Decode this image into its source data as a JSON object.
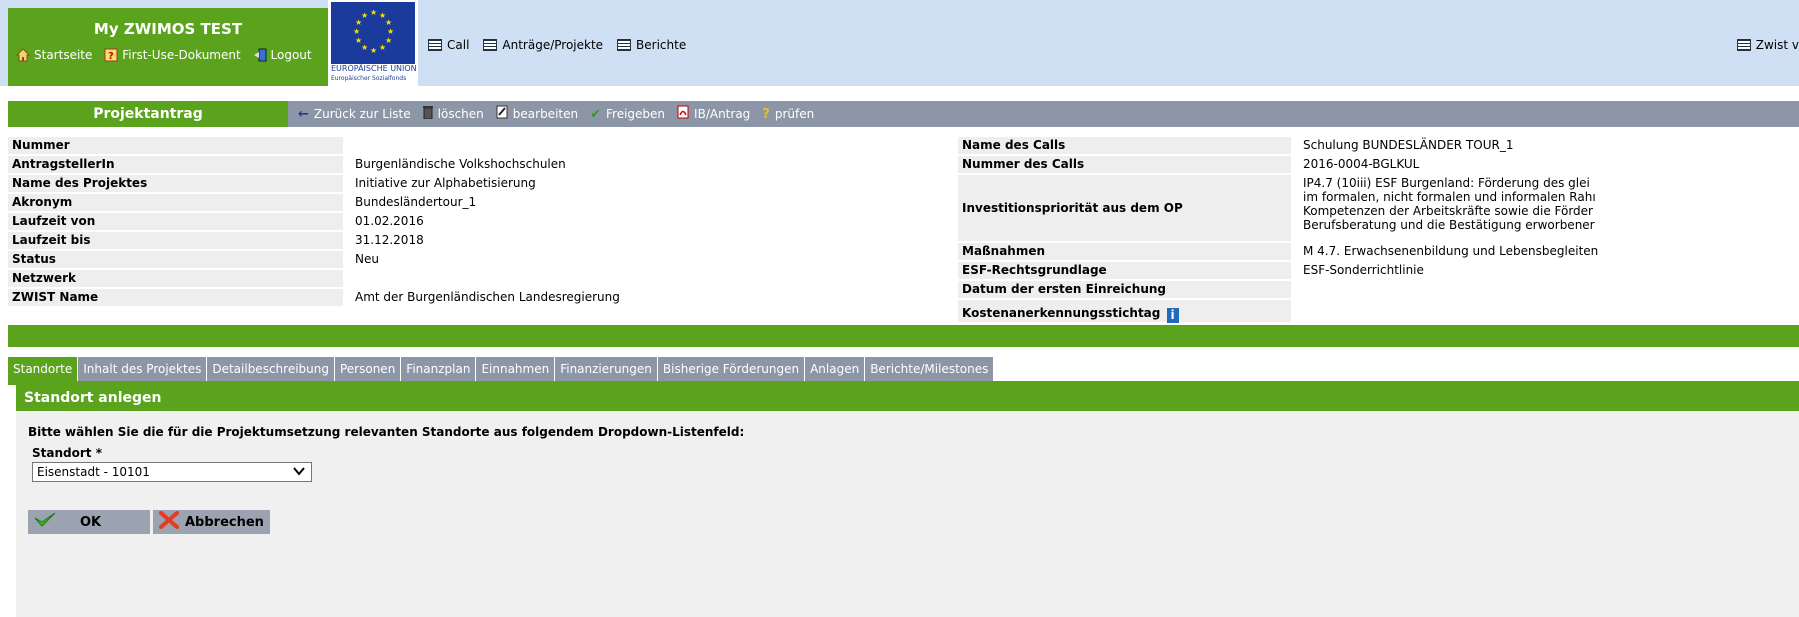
{
  "header": {
    "app_title": "My ZWIMOS TEST",
    "links": [
      {
        "label": "Startseite",
        "icon": "home-icon"
      },
      {
        "label": "First-Use-Dokument",
        "icon": "help-icon"
      },
      {
        "label": "Logout",
        "icon": "logout-icon"
      }
    ],
    "eu_line1": "EUROPÄISCHE UNION",
    "eu_line2": "Europäischer Sozialfonds",
    "nav": [
      {
        "label": "Call",
        "icon": "list-icon"
      },
      {
        "label": "Anträge/Projekte",
        "icon": "list-icon"
      },
      {
        "label": "Berichte",
        "icon": "list-icon"
      }
    ],
    "nav_right": "Zwist v"
  },
  "actionbar": {
    "title": "Projektantrag",
    "actions": [
      {
        "label": "Zurück zur Liste",
        "icon": "arrow-left-icon",
        "glyph": "←"
      },
      {
        "label": "löschen",
        "icon": "trash-icon",
        "glyph": "🗑"
      },
      {
        "label": "bearbeiten",
        "icon": "edit-icon",
        "glyph": "✎"
      },
      {
        "label": "Freigeben",
        "icon": "check-icon",
        "glyph": "✔"
      },
      {
        "label": "IB/Antrag",
        "icon": "pdf-icon",
        "glyph": "▣"
      },
      {
        "label": "prüfen",
        "icon": "question-icon",
        "glyph": "?"
      }
    ]
  },
  "project_info": [
    {
      "label": "Nummer",
      "value": ""
    },
    {
      "label": "AntragstellerIn",
      "value": "Burgenländische Volkshochschulen"
    },
    {
      "label": "Name des Projektes",
      "value": "Initiative zur Alphabetisierung"
    },
    {
      "label": "Akronym",
      "value": "Bundesländertour_1"
    },
    {
      "label": "Laufzeit von",
      "value": "01.02.2016"
    },
    {
      "label": "Laufzeit bis",
      "value": "31.12.2018"
    },
    {
      "label": "Status",
      "value": "Neu"
    },
    {
      "label": "Netzwerk",
      "value": ""
    },
    {
      "label": "ZWIST Name",
      "value": "Amt der Burgenländischen Landesregierung"
    }
  ],
  "call_info": {
    "name_label": "Name des Calls",
    "name_value": "Schulung BUNDESLÄNDER TOUR_1",
    "number_label": "Nummer des Calls",
    "number_value": "2016-0004-BGLKUL",
    "invest_label": "Investitionspriorität aus dem OP",
    "invest_lines": [
      "IP4.7 (10iii) ESF Burgenland: Förderung des glei",
      "im formalen, nicht formalen und informalen Rahı",
      "Kompetenzen der Arbeitskräfte sowie die Förder",
      "Berufsberatung und die Bestätigung erworbener"
    ],
    "massnahmen_label": "Maßnahmen",
    "massnahmen_value": "M 4.7. Erwachsenenbildung und Lebensbegleiten",
    "esf_label": "ESF-Rechtsgrundlage",
    "esf_value": "ESF-Sonderrichtlinie",
    "datum_label": "Datum der ersten Einreichung",
    "datum_value": "",
    "kosten_label": "Kostenanerkennungsstichtag"
  },
  "tabs": [
    {
      "label": "Standorte",
      "active": true
    },
    {
      "label": "Inhalt des Projektes",
      "active": false
    },
    {
      "label": "Detailbeschreibung",
      "active": false
    },
    {
      "label": "Personen",
      "active": false
    },
    {
      "label": "Finanzplan",
      "active": false
    },
    {
      "label": "Einnahmen",
      "active": false
    },
    {
      "label": "Finanzierungen",
      "active": false
    },
    {
      "label": "Bisherige Förderungen",
      "active": false
    },
    {
      "label": "Anlagen",
      "active": false
    },
    {
      "label": "Berichte/Milestones",
      "active": false
    }
  ],
  "form": {
    "title": "Standort anlegen",
    "instruction": "Bitte wählen Sie die für die Projektumsetzung relevanten Standorte aus folgendem Dropdown-Listenfeld:",
    "field_label": "Standort",
    "required_mark": "*",
    "selected": "Eisenstadt - 10101",
    "ok_label": "OK",
    "cancel_label": "Abbrechen"
  },
  "colors": {
    "green": "#5ba31c",
    "header_bg": "#cfe0f5",
    "grey_bar": "#8d96a6"
  }
}
